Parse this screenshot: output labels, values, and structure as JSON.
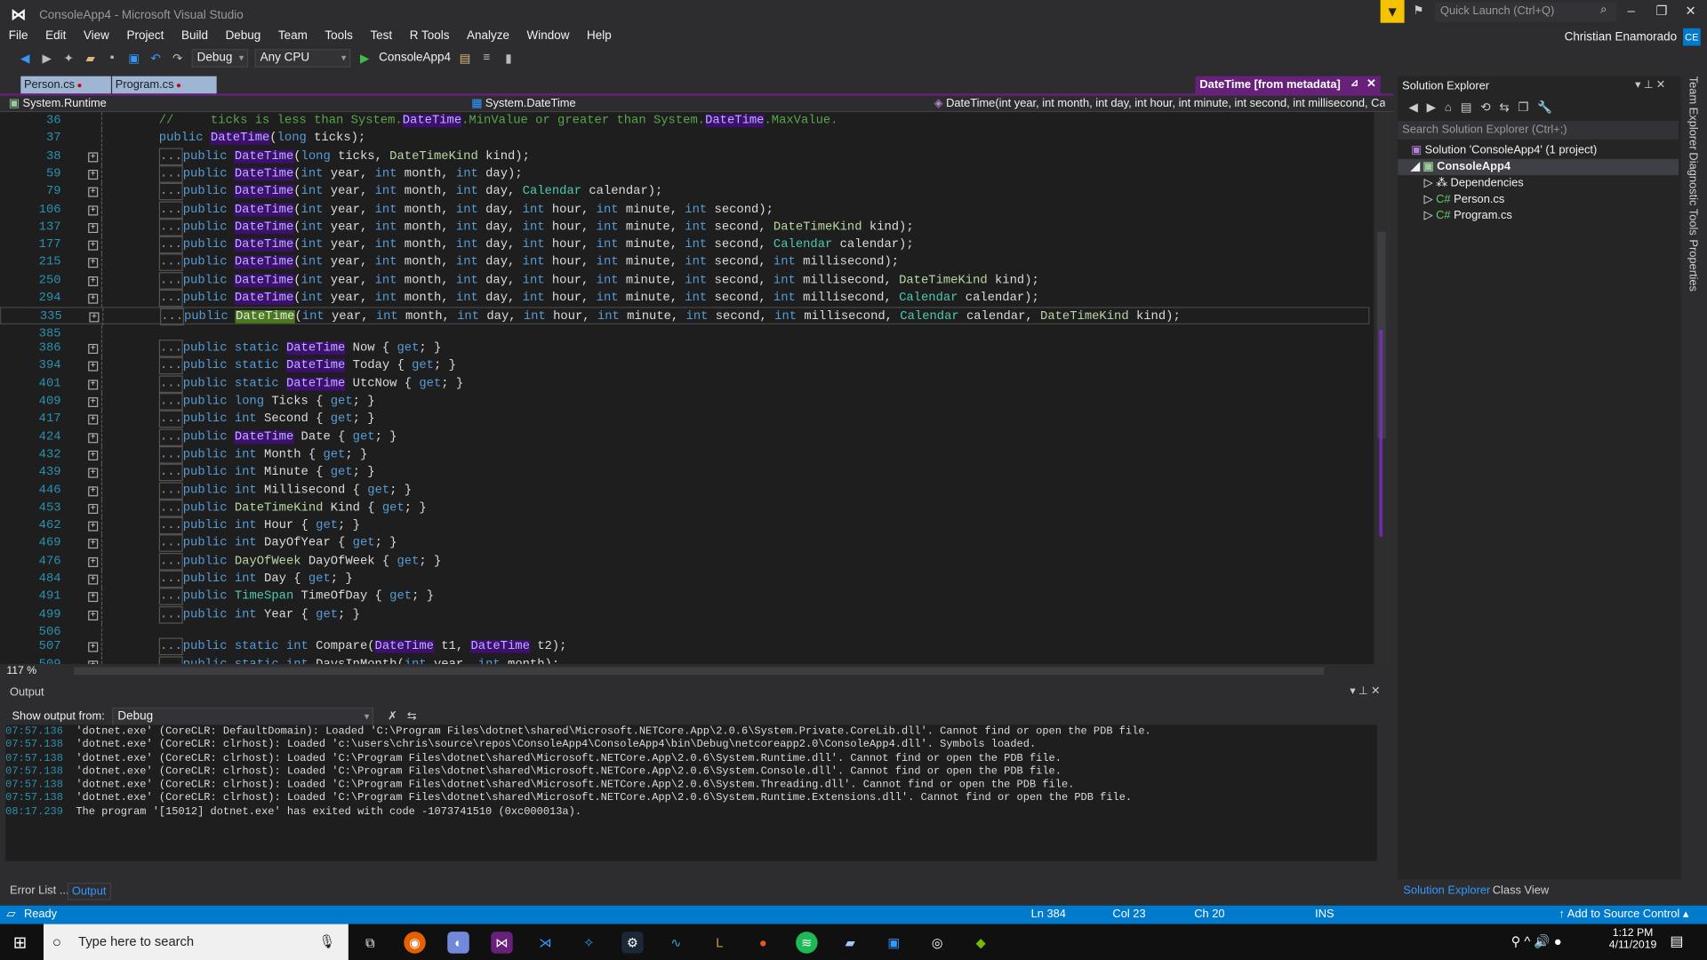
{
  "window": {
    "title": "ConsoleApp4 - Microsoft Visual Studio",
    "quick_launch": "Quick Launch (Ctrl+Q)",
    "user": "Christian Enamorado",
    "avatar": "CE"
  },
  "menu": [
    "File",
    "Edit",
    "View",
    "Project",
    "Build",
    "Debug",
    "Team",
    "Tools",
    "Test",
    "R Tools",
    "Analyze",
    "Window",
    "Help"
  ],
  "toolbar": {
    "config": "Debug",
    "platform": "Any CPU",
    "start": "ConsoleApp4"
  },
  "tabs": [
    {
      "label": "Person.cs"
    },
    {
      "label": "Program.cs"
    }
  ],
  "metadata_tab": "DateTime [from metadata]",
  "nav": {
    "project": "System.Runtime",
    "type": "System.DateTime",
    "member": "DateTime(int year, int month, int day, int hour, int minute, int second, int millisecond, Caler"
  },
  "colors": {
    "accent": "#007acc",
    "tab_purple": "#68217a",
    "keyword": "#569cd6",
    "type": "#4ec9b0"
  },
  "code": [
    {
      "n": "36",
      "fold": false,
      "t": [
        [
          "cm",
          "//     ticks is less than System."
        ],
        [
          "hl",
          "DateTime"
        ],
        [
          "cm",
          ".MinValue or greater than System."
        ],
        [
          "hl",
          "DateTime"
        ],
        [
          "cm",
          ".MaxValue."
        ]
      ]
    },
    {
      "n": "37",
      "fold": false,
      "t": [
        [
          "kw",
          "public "
        ],
        [
          "hl",
          "DateTime"
        ],
        [
          "pl",
          "("
        ],
        [
          "kw",
          "long"
        ],
        [
          "pl",
          " ticks);"
        ]
      ]
    },
    {
      "n": "38",
      "fold": true,
      "t": [
        [
          "kw",
          "public "
        ],
        [
          "hl",
          "DateTime"
        ],
        [
          "pl",
          "("
        ],
        [
          "kw",
          "long"
        ],
        [
          "pl",
          " ticks, "
        ],
        [
          "en",
          "DateTimeKind"
        ],
        [
          "pl",
          " kind);"
        ]
      ]
    },
    {
      "n": "59",
      "fold": true,
      "t": [
        [
          "kw",
          "public "
        ],
        [
          "hl",
          "DateTime"
        ],
        [
          "pl",
          "("
        ],
        [
          "kw",
          "int"
        ],
        [
          "pl",
          " year, "
        ],
        [
          "kw",
          "int"
        ],
        [
          "pl",
          " month, "
        ],
        [
          "kw",
          "int"
        ],
        [
          "pl",
          " day);"
        ]
      ]
    },
    {
      "n": "79",
      "fold": true,
      "t": [
        [
          "kw",
          "public "
        ],
        [
          "hl",
          "DateTime"
        ],
        [
          "pl",
          "("
        ],
        [
          "kw",
          "int"
        ],
        [
          "pl",
          " year, "
        ],
        [
          "kw",
          "int"
        ],
        [
          "pl",
          " month, "
        ],
        [
          "kw",
          "int"
        ],
        [
          "pl",
          " day, "
        ],
        [
          "ty",
          "Calendar"
        ],
        [
          "pl",
          " calendar);"
        ]
      ]
    },
    {
      "n": "106",
      "fold": true,
      "t": [
        [
          "kw",
          "public "
        ],
        [
          "hl",
          "DateTime"
        ],
        [
          "pl",
          "("
        ],
        [
          "kw",
          "int"
        ],
        [
          "pl",
          " year, "
        ],
        [
          "kw",
          "int"
        ],
        [
          "pl",
          " month, "
        ],
        [
          "kw",
          "int"
        ],
        [
          "pl",
          " day, "
        ],
        [
          "kw",
          "int"
        ],
        [
          "pl",
          " hour, "
        ],
        [
          "kw",
          "int"
        ],
        [
          "pl",
          " minute, "
        ],
        [
          "kw",
          "int"
        ],
        [
          "pl",
          " second);"
        ]
      ]
    },
    {
      "n": "137",
      "fold": true,
      "t": [
        [
          "kw",
          "public "
        ],
        [
          "hl",
          "DateTime"
        ],
        [
          "pl",
          "("
        ],
        [
          "kw",
          "int"
        ],
        [
          "pl",
          " year, "
        ],
        [
          "kw",
          "int"
        ],
        [
          "pl",
          " month, "
        ],
        [
          "kw",
          "int"
        ],
        [
          "pl",
          " day, "
        ],
        [
          "kw",
          "int"
        ],
        [
          "pl",
          " hour, "
        ],
        [
          "kw",
          "int"
        ],
        [
          "pl",
          " minute, "
        ],
        [
          "kw",
          "int"
        ],
        [
          "pl",
          " second, "
        ],
        [
          "en",
          "DateTimeKind"
        ],
        [
          "pl",
          " kind);"
        ]
      ]
    },
    {
      "n": "177",
      "fold": true,
      "t": [
        [
          "kw",
          "public "
        ],
        [
          "hl",
          "DateTime"
        ],
        [
          "pl",
          "("
        ],
        [
          "kw",
          "int"
        ],
        [
          "pl",
          " year, "
        ],
        [
          "kw",
          "int"
        ],
        [
          "pl",
          " month, "
        ],
        [
          "kw",
          "int"
        ],
        [
          "pl",
          " day, "
        ],
        [
          "kw",
          "int"
        ],
        [
          "pl",
          " hour, "
        ],
        [
          "kw",
          "int"
        ],
        [
          "pl",
          " minute, "
        ],
        [
          "kw",
          "int"
        ],
        [
          "pl",
          " second, "
        ],
        [
          "ty",
          "Calendar"
        ],
        [
          "pl",
          " calendar);"
        ]
      ]
    },
    {
      "n": "215",
      "fold": true,
      "t": [
        [
          "kw",
          "public "
        ],
        [
          "hl",
          "DateTime"
        ],
        [
          "pl",
          "("
        ],
        [
          "kw",
          "int"
        ],
        [
          "pl",
          " year, "
        ],
        [
          "kw",
          "int"
        ],
        [
          "pl",
          " month, "
        ],
        [
          "kw",
          "int"
        ],
        [
          "pl",
          " day, "
        ],
        [
          "kw",
          "int"
        ],
        [
          "pl",
          " hour, "
        ],
        [
          "kw",
          "int"
        ],
        [
          "pl",
          " minute, "
        ],
        [
          "kw",
          "int"
        ],
        [
          "pl",
          " second, "
        ],
        [
          "kw",
          "int"
        ],
        [
          "pl",
          " millisecond);"
        ]
      ]
    },
    {
      "n": "250",
      "fold": true,
      "t": [
        [
          "kw",
          "public "
        ],
        [
          "hl",
          "DateTime"
        ],
        [
          "pl",
          "("
        ],
        [
          "kw",
          "int"
        ],
        [
          "pl",
          " year, "
        ],
        [
          "kw",
          "int"
        ],
        [
          "pl",
          " month, "
        ],
        [
          "kw",
          "int"
        ],
        [
          "pl",
          " day, "
        ],
        [
          "kw",
          "int"
        ],
        [
          "pl",
          " hour, "
        ],
        [
          "kw",
          "int"
        ],
        [
          "pl",
          " minute, "
        ],
        [
          "kw",
          "int"
        ],
        [
          "pl",
          " second, "
        ],
        [
          "kw",
          "int"
        ],
        [
          "pl",
          " millisecond, "
        ],
        [
          "en",
          "DateTimeKind"
        ],
        [
          "pl",
          " kind);"
        ]
      ]
    },
    {
      "n": "294",
      "fold": true,
      "t": [
        [
          "kw",
          "public "
        ],
        [
          "hl",
          "DateTime"
        ],
        [
          "pl",
          "("
        ],
        [
          "kw",
          "int"
        ],
        [
          "pl",
          " year, "
        ],
        [
          "kw",
          "int"
        ],
        [
          "pl",
          " month, "
        ],
        [
          "kw",
          "int"
        ],
        [
          "pl",
          " day, "
        ],
        [
          "kw",
          "int"
        ],
        [
          "pl",
          " hour, "
        ],
        [
          "kw",
          "int"
        ],
        [
          "pl",
          " minute, "
        ],
        [
          "kw",
          "int"
        ],
        [
          "pl",
          " second, "
        ],
        [
          "kw",
          "int"
        ],
        [
          "pl",
          " millisecond, "
        ],
        [
          "ty",
          "Calendar"
        ],
        [
          "pl",
          " calendar);"
        ]
      ]
    },
    {
      "n": "335",
      "fold": true,
      "current": true,
      "t": [
        [
          "kw",
          "public "
        ],
        [
          "cur",
          "DateTime"
        ],
        [
          "pl",
          "("
        ],
        [
          "kw",
          "int"
        ],
        [
          "pl",
          " year, "
        ],
        [
          "kw",
          "int"
        ],
        [
          "pl",
          " month, "
        ],
        [
          "kw",
          "int"
        ],
        [
          "pl",
          " day, "
        ],
        [
          "kw",
          "int"
        ],
        [
          "pl",
          " hour, "
        ],
        [
          "kw",
          "int"
        ],
        [
          "pl",
          " minute, "
        ],
        [
          "kw",
          "int"
        ],
        [
          "pl",
          " second, "
        ],
        [
          "kw",
          "int"
        ],
        [
          "pl",
          " millisecond, "
        ],
        [
          "ty",
          "Calendar"
        ],
        [
          "pl",
          " calendar, "
        ],
        [
          "en",
          "DateTimeKind"
        ],
        [
          "pl",
          " kind);"
        ]
      ]
    },
    {
      "n": "385",
      "fold": false,
      "t": []
    },
    {
      "n": "386",
      "fold": true,
      "t": [
        [
          "kw",
          "public static "
        ],
        [
          "hl",
          "DateTime"
        ],
        [
          "pl",
          " Now { "
        ],
        [
          "kw",
          "get"
        ],
        [
          "pl",
          "; }"
        ]
      ]
    },
    {
      "n": "394",
      "fold": true,
      "t": [
        [
          "kw",
          "public static "
        ],
        [
          "hl",
          "DateTime"
        ],
        [
          "pl",
          " Today { "
        ],
        [
          "kw",
          "get"
        ],
        [
          "pl",
          "; }"
        ]
      ]
    },
    {
      "n": "401",
      "fold": true,
      "t": [
        [
          "kw",
          "public static "
        ],
        [
          "hl",
          "DateTime"
        ],
        [
          "pl",
          " UtcNow { "
        ],
        [
          "kw",
          "get"
        ],
        [
          "pl",
          "; }"
        ]
      ]
    },
    {
      "n": "409",
      "fold": true,
      "t": [
        [
          "kw",
          "public long"
        ],
        [
          "pl",
          " Ticks { "
        ],
        [
          "kw",
          "get"
        ],
        [
          "pl",
          "; }"
        ]
      ]
    },
    {
      "n": "417",
      "fold": true,
      "t": [
        [
          "kw",
          "public int"
        ],
        [
          "pl",
          " Second { "
        ],
        [
          "kw",
          "get"
        ],
        [
          "pl",
          "; }"
        ]
      ]
    },
    {
      "n": "424",
      "fold": true,
      "t": [
        [
          "kw",
          "public "
        ],
        [
          "hl",
          "DateTime"
        ],
        [
          "pl",
          " Date { "
        ],
        [
          "kw",
          "get"
        ],
        [
          "pl",
          "; }"
        ]
      ]
    },
    {
      "n": "432",
      "fold": true,
      "t": [
        [
          "kw",
          "public int"
        ],
        [
          "pl",
          " Month { "
        ],
        [
          "kw",
          "get"
        ],
        [
          "pl",
          "; }"
        ]
      ]
    },
    {
      "n": "439",
      "fold": true,
      "t": [
        [
          "kw",
          "public int"
        ],
        [
          "pl",
          " Minute { "
        ],
        [
          "kw",
          "get"
        ],
        [
          "pl",
          "; }"
        ]
      ]
    },
    {
      "n": "446",
      "fold": true,
      "t": [
        [
          "kw",
          "public int"
        ],
        [
          "pl",
          " Millisecond { "
        ],
        [
          "kw",
          "get"
        ],
        [
          "pl",
          "; }"
        ]
      ]
    },
    {
      "n": "453",
      "fold": true,
      "t": [
        [
          "kw",
          "public "
        ],
        [
          "en",
          "DateTimeKind"
        ],
        [
          "pl",
          " Kind { "
        ],
        [
          "kw",
          "get"
        ],
        [
          "pl",
          "; }"
        ]
      ]
    },
    {
      "n": "462",
      "fold": true,
      "t": [
        [
          "kw",
          "public int"
        ],
        [
          "pl",
          " Hour { "
        ],
        [
          "kw",
          "get"
        ],
        [
          "pl",
          "; }"
        ]
      ]
    },
    {
      "n": "469",
      "fold": true,
      "t": [
        [
          "kw",
          "public int"
        ],
        [
          "pl",
          " DayOfYear { "
        ],
        [
          "kw",
          "get"
        ],
        [
          "pl",
          "; }"
        ]
      ]
    },
    {
      "n": "476",
      "fold": true,
      "t": [
        [
          "kw",
          "public "
        ],
        [
          "en",
          "DayOfWeek"
        ],
        [
          "pl",
          " DayOfWeek { "
        ],
        [
          "kw",
          "get"
        ],
        [
          "pl",
          "; }"
        ]
      ]
    },
    {
      "n": "484",
      "fold": true,
      "t": [
        [
          "kw",
          "public int"
        ],
        [
          "pl",
          " Day { "
        ],
        [
          "kw",
          "get"
        ],
        [
          "pl",
          "; }"
        ]
      ]
    },
    {
      "n": "491",
      "fold": true,
      "t": [
        [
          "kw",
          "public "
        ],
        [
          "ty",
          "TimeSpan"
        ],
        [
          "pl",
          " TimeOfDay { "
        ],
        [
          "kw",
          "get"
        ],
        [
          "pl",
          "; }"
        ]
      ]
    },
    {
      "n": "499",
      "fold": true,
      "t": [
        [
          "kw",
          "public int"
        ],
        [
          "pl",
          " Year { "
        ],
        [
          "kw",
          "get"
        ],
        [
          "pl",
          "; }"
        ]
      ]
    },
    {
      "n": "506",
      "fold": false,
      "t": []
    },
    {
      "n": "507",
      "fold": true,
      "t": [
        [
          "kw",
          "public static int"
        ],
        [
          "pl",
          " Compare("
        ],
        [
          "hl",
          "DateTime"
        ],
        [
          "pl",
          " t1, "
        ],
        [
          "hl",
          "DateTime"
        ],
        [
          "pl",
          " t2);"
        ]
      ]
    },
    {
      "n": "509",
      "fold": true,
      "t": [
        [
          "kw",
          "public static int"
        ],
        [
          "pl",
          " DaysInMonth("
        ],
        [
          "kw",
          "int"
        ],
        [
          "pl",
          " year, "
        ],
        [
          "kw",
          "int"
        ],
        [
          "pl",
          " month);"
        ]
      ]
    }
  ],
  "zoom": "117 %",
  "output": {
    "title": "Output",
    "show_from_label": "Show output from:",
    "source": "Debug",
    "lines": [
      {
        "ts": "07:57.136",
        "text": "'dotnet.exe' (CoreCLR: DefaultDomain): Loaded 'C:\\Program Files\\dotnet\\shared\\Microsoft.NETCore.App\\2.0.6\\System.Private.CoreLib.dll'. Cannot find or open the PDB file."
      },
      {
        "ts": "07:57.138",
        "text": "'dotnet.exe' (CoreCLR: clrhost): Loaded 'c:\\users\\chris\\source\\repos\\ConsoleApp4\\ConsoleApp4\\bin\\Debug\\netcoreapp2.0\\ConsoleApp4.dll'. Symbols loaded."
      },
      {
        "ts": "07:57.138",
        "text": "'dotnet.exe' (CoreCLR: clrhost): Loaded 'C:\\Program Files\\dotnet\\shared\\Microsoft.NETCore.App\\2.0.6\\System.Runtime.dll'. Cannot find or open the PDB file."
      },
      {
        "ts": "07:57.138",
        "text": "'dotnet.exe' (CoreCLR: clrhost): Loaded 'C:\\Program Files\\dotnet\\shared\\Microsoft.NETCore.App\\2.0.6\\System.Console.dll'. Cannot find or open the PDB file."
      },
      {
        "ts": "07:57.138",
        "text": "'dotnet.exe' (CoreCLR: clrhost): Loaded 'C:\\Program Files\\dotnet\\shared\\Microsoft.NETCore.App\\2.0.6\\System.Threading.dll'. Cannot find or open the PDB file."
      },
      {
        "ts": "07:57.138",
        "text": "'dotnet.exe' (CoreCLR: clrhost): Loaded 'C:\\Program Files\\dotnet\\shared\\Microsoft.NETCore.App\\2.0.6\\System.Runtime.Extensions.dll'. Cannot find or open the PDB file."
      },
      {
        "ts": "08:17.239",
        "text": "The program '[15012] dotnet.exe' has exited with code -1073741510 (0xc000013a)."
      }
    ]
  },
  "bottom_tabs": {
    "error_list": "Error List ...",
    "output": "Output"
  },
  "solution_explorer": {
    "title": "Solution Explorer",
    "search": "Search Solution Explorer (Ctrl+;)",
    "solution": "Solution 'ConsoleApp4' (1 project)",
    "project": "ConsoleApp4",
    "items": [
      "Dependencies",
      "Person.cs",
      "Program.cs"
    ],
    "tabs": [
      "Solution Explorer",
      "Class View"
    ]
  },
  "side_tabs": [
    "Team Explorer",
    "Diagnostic Tools",
    "Properties"
  ],
  "status": {
    "ready": "Ready",
    "ln": "Ln 384",
    "col": "Col 23",
    "ch": "Ch 20",
    "mode": "INS",
    "source_control": "Add to Source Control"
  },
  "taskbar": {
    "search": "Type here to search",
    "time": "1:12 PM",
    "date": "4/11/2019"
  }
}
